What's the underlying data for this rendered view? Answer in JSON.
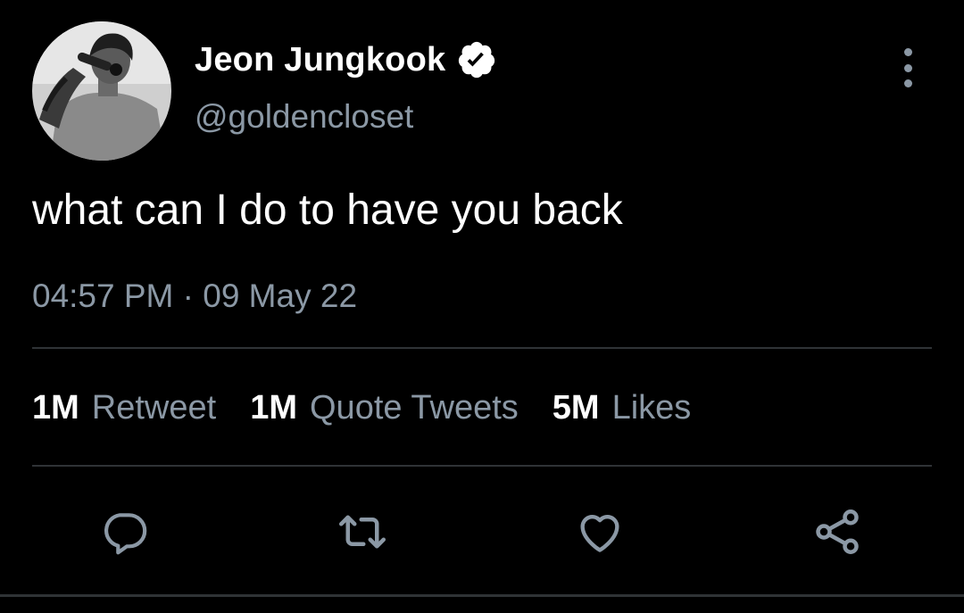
{
  "tweet": {
    "author": {
      "display_name": "Jeon Jungkook",
      "handle": "@goldencloset",
      "verified": true
    },
    "text": "what can I do to have you back",
    "timestamp": "04:57 PM · 09 May 22",
    "stats": [
      {
        "count": "1M",
        "label": "Retweet"
      },
      {
        "count": "1M",
        "label": "Quote Tweets"
      },
      {
        "count": "5M",
        "label": "Likes"
      }
    ]
  },
  "icons": {
    "menu": "more-vertical-icon",
    "verified": "verified-badge-icon",
    "actions": [
      "reply-icon",
      "retweet-icon",
      "like-icon",
      "share-icon"
    ]
  },
  "colors": {
    "background": "#000000",
    "text_primary": "#ffffff",
    "text_secondary": "#8b98a5",
    "divider": "#2f3336"
  }
}
